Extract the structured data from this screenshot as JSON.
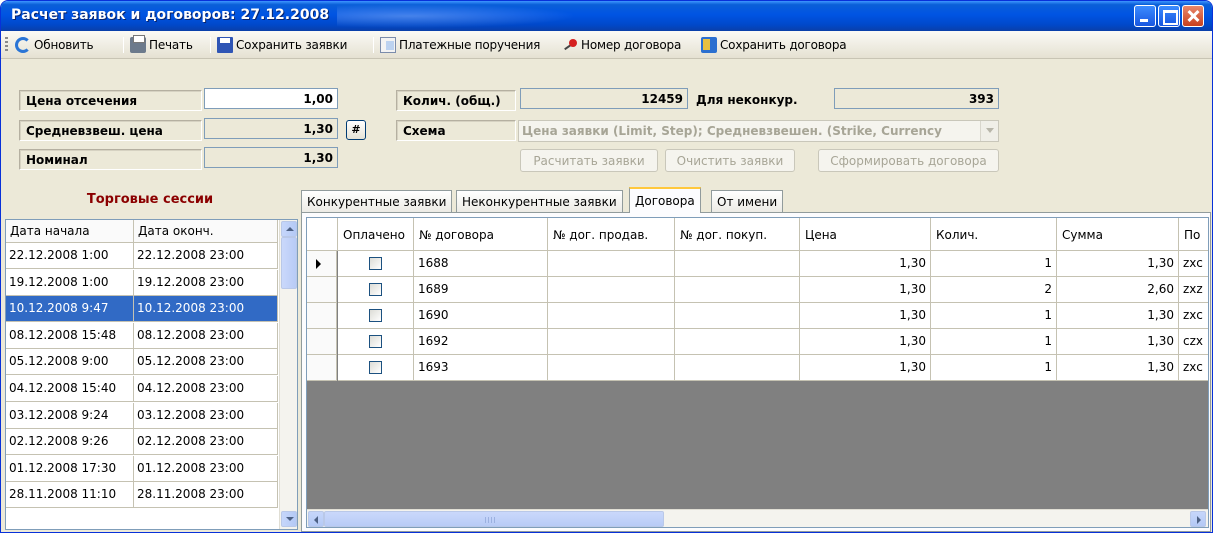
{
  "window": {
    "title": "Расчет заявок и договоров: 27.12.2008",
    "accent": "#0054e3"
  },
  "toolbar": {
    "refresh": "Обновить",
    "print": "Печать",
    "save_bids": "Сохранить заявки",
    "payment_orders": "Платежные поручения",
    "contract_number": "Номер договора",
    "save_contract": "Сохранить договора"
  },
  "form": {
    "cutoff_price_label": "Цена отсечения",
    "cutoff_price_value": "1,00",
    "avg_price_label": "Средневзвеш. цена",
    "avg_price_value": "1,30",
    "nominal_label": "Номинал",
    "nominal_value": "1,30",
    "hash_button": "#",
    "qty_total_label": "Колич. (общ.)",
    "qty_total_value": "12459",
    "noncompetitive_label": "Для неконкур.",
    "noncompetitive_value": "393",
    "scheme_label": "Схема",
    "scheme_value": "Цена заявки (Limit, Step); Средневзвешен. (Strike, Currency",
    "calc_button": "Расчитать заявки",
    "clear_button": "Очистить заявки",
    "form_contracts_button": "Сформировать договора"
  },
  "sessions": {
    "title": "Торговые сессии",
    "columns": [
      "Дата начала",
      "Дата оконч."
    ],
    "rows": [
      {
        "start": "22.12.2008 1:00",
        "end": "22.12.2008 23:00"
      },
      {
        "start": "19.12.2008 1:00",
        "end": "19.12.2008 23:00"
      },
      {
        "start": "10.12.2008 9:47",
        "end": "10.12.2008 23:00"
      },
      {
        "start": "08.12.2008 15:48",
        "end": "08.12.2008 23:00"
      },
      {
        "start": "05.12.2008 9:00",
        "end": "05.12.2008 23:00"
      },
      {
        "start": "04.12.2008 15:40",
        "end": "04.12.2008 23:00"
      },
      {
        "start": "03.12.2008 9:24",
        "end": "03.12.2008 23:00"
      },
      {
        "start": "02.12.2008 9:26",
        "end": "02.12.2008 23:00"
      },
      {
        "start": "01.12.2008 17:30",
        "end": "01.12.2008 23:00"
      },
      {
        "start": "28.11.2008 11:10",
        "end": "28.11.2008 23:00"
      }
    ],
    "selected_index": 2
  },
  "tabs": [
    {
      "label": "Конкурентные заявки"
    },
    {
      "label": "Неконкурентные заявки"
    },
    {
      "label": "Договора"
    },
    {
      "label": "От имени"
    }
  ],
  "contracts": {
    "columns": [
      "Оплачено",
      "№ договора",
      "№ дог. продав.",
      "№ дог. покуп.",
      "Цена",
      "Колич.",
      "Сумма",
      "По"
    ],
    "rows": [
      {
        "paid": false,
        "number": "1688",
        "seller": "",
        "buyer": "",
        "price": "1,30",
        "qty": "1",
        "sum": "1,30",
        "extra": "zxc"
      },
      {
        "paid": false,
        "number": "1689",
        "seller": "",
        "buyer": "",
        "price": "1,30",
        "qty": "2",
        "sum": "2,60",
        "extra": "zxz"
      },
      {
        "paid": false,
        "number": "1690",
        "seller": "",
        "buyer": "",
        "price": "1,30",
        "qty": "1",
        "sum": "1,30",
        "extra": "zxc"
      },
      {
        "paid": false,
        "number": "1692",
        "seller": "",
        "buyer": "",
        "price": "1,30",
        "qty": "1",
        "sum": "1,30",
        "extra": "czx"
      },
      {
        "paid": false,
        "number": "1693",
        "seller": "",
        "buyer": "",
        "price": "1,30",
        "qty": "1",
        "sum": "1,30",
        "extra": "zxc"
      }
    ],
    "current_row": 0
  }
}
